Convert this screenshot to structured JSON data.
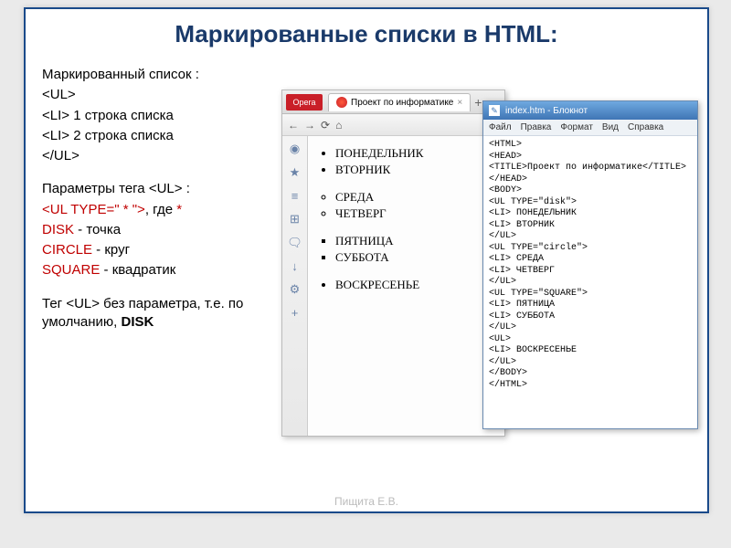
{
  "slide": {
    "title": "Маркированные списки в HTML:",
    "footer": "Пищита Е.В."
  },
  "text": {
    "l1": "Маркированный список :",
    "l2": "<UL>",
    "l3": "<LI> 1 строка списка",
    "l4": "<LI> 2 строка списка",
    "l5": "</UL>",
    "p1a": "Параметры тега ",
    "p1b": "<UL>",
    "p1c": " :",
    "p2a": "<UL  TYPE=\" ",
    "p2b": "*",
    "p2c": " \">",
    "p2d": ", где ",
    "p2e": "*",
    "d1a": "DISK",
    "d1b": "  - точка",
    "d2a": "CIRCLE",
    "d2b": "  - круг",
    "d3a": "SQUARE",
    "d3b": "  - квадратик",
    "t1a": "Тег ",
    "t1b": "<UL>",
    "t1c": "  без параметра, т.е. по умолчанию, ",
    "t1d": "DISK"
  },
  "browser": {
    "app": "Opera",
    "tab": "Проект по информатике",
    "days": {
      "d1": "ПОНЕДЕЛЬНИК",
      "d2": "ВТОРНИК",
      "d3": "СРЕДА",
      "d4": "ЧЕТВЕРГ",
      "d5": "ПЯТНИЦА",
      "d6": "СУББОТА",
      "d7": "ВОСКРЕСЕНЬЕ"
    },
    "sidebar": [
      "◉",
      "★",
      "≡",
      "⊞",
      "🗨",
      "↓",
      "⚙",
      "+"
    ]
  },
  "notepad": {
    "title": "index.htm - Блокнот",
    "menu": {
      "m1": "Файл",
      "m2": "Правка",
      "m3": "Формат",
      "m4": "Вид",
      "m5": "Справка"
    },
    "code": "<HTML>\n<HEAD>\n<TITLE>Проект по информатике</TITLE>\n</HEAD>\n<BODY>\n<UL TYPE=\"disk\">\n<LI> ПОНЕДЕЛЬНИК\n<LI> ВТОРНИК\n</UL>\n<UL TYPE=\"circle\">\n<LI> СРЕДА\n<LI> ЧЕТВЕРГ\n</UL>\n<UL TYPE=\"SQUARE\">\n<LI> ПЯТНИЦА\n<LI> СУББОТА\n</UL>\n<UL>\n<LI> ВОСКРЕСЕНЬЕ\n</UL>\n</BODY>\n</HTML>"
  }
}
